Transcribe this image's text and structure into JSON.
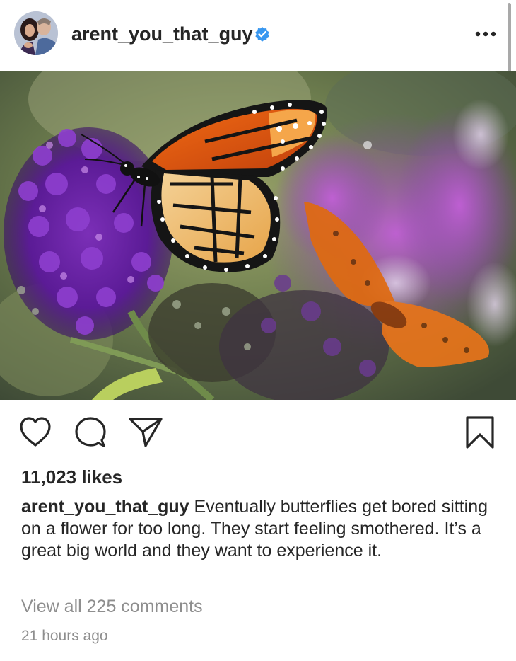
{
  "post": {
    "username": "arent_you_that_guy",
    "verified": true,
    "verified_badge_color": "#3897f0",
    "more_options_icon": "more-horizontal-icon",
    "image_subject": "monarch-butterfly-on-purple-flowers-photo",
    "actions": {
      "like_icon": "heart-icon",
      "comment_icon": "comment-icon",
      "share_icon": "send-icon",
      "save_icon": "bookmark-icon"
    },
    "likes_text": "11,023 likes",
    "caption_username": "arent_you_that_guy",
    "caption_text": " Eventually butterflies get bored sitting on a flower for too long. They start feeling smothered. It’s a great big world and they want to experience it.",
    "view_comments_text": "View all 225 comments",
    "timestamp": "21 hours ago"
  },
  "colors": {
    "text_primary": "#262626",
    "text_secondary": "#8e8e8e",
    "background": "#ffffff"
  }
}
